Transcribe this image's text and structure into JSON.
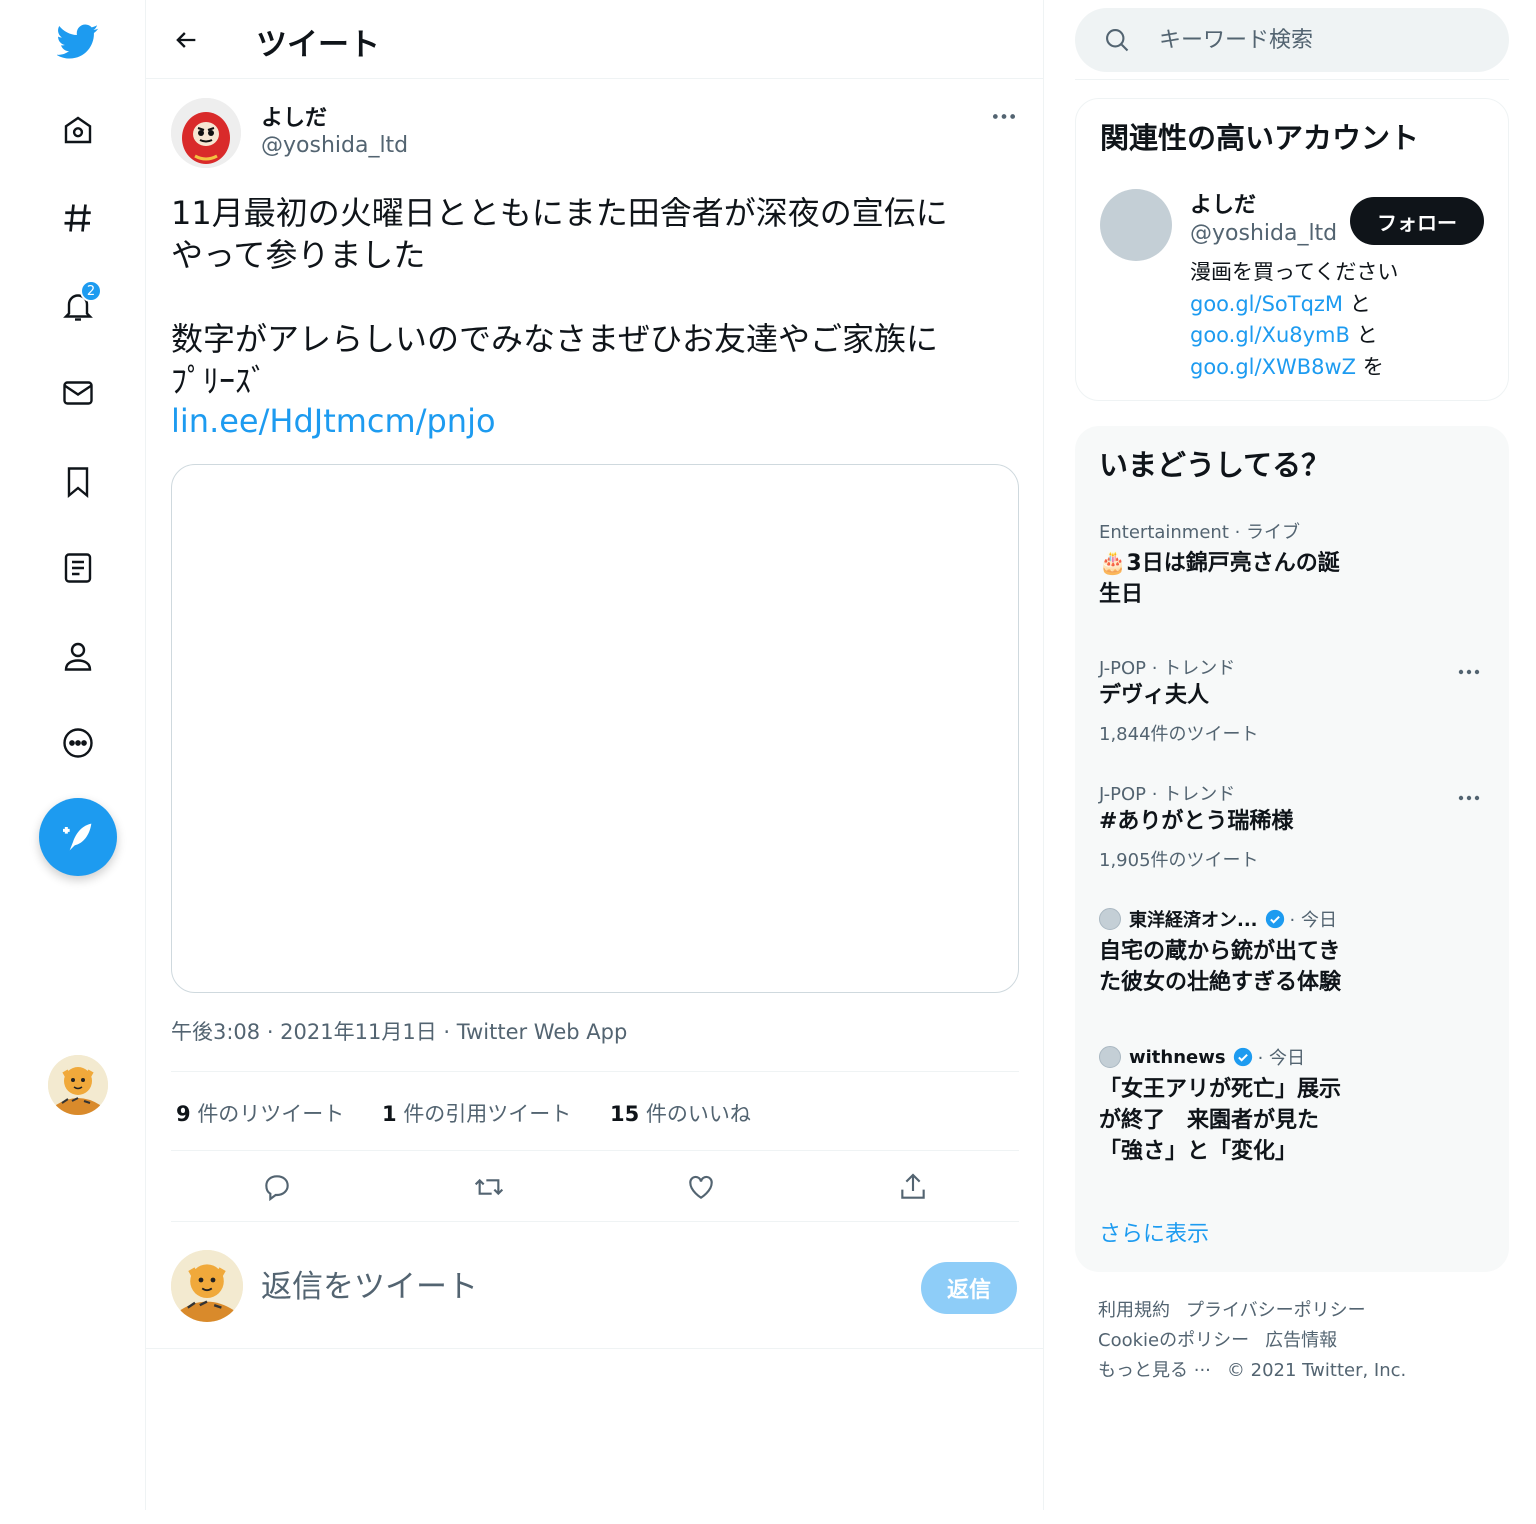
{
  "nav": {
    "notification_count": "2",
    "icons": [
      "twitter-logo-icon",
      "home-icon",
      "explore-hash-icon",
      "bell-icon",
      "mail-icon",
      "bookmark-icon",
      "lists-icon",
      "profile-icon",
      "more-icon",
      "compose-icon"
    ]
  },
  "header": {
    "title": "ツイート"
  },
  "tweet": {
    "author_name": "よしだ",
    "author_handle": "@yoshida_ltd",
    "text_line1": "11月最初の火曜日とともにまた田舎者が深夜の宣伝に",
    "text_line2": "やって参りました",
    "text_line3": "数字がアレらしいのでみなさまぜひお友達やご家族に",
    "text_line4": "ﾌﾟﾘｰｽﾞ",
    "link": "lin.ee/HdJtmcm/pnjo",
    "meta": "午後3:08 · 2021年11月1日 · Twitter Web App",
    "retweets": {
      "count": "9",
      "label": "件のリツイート"
    },
    "quotes": {
      "count": "1",
      "label": "件の引用ツイート"
    },
    "likes": {
      "count": "15",
      "label": "件のいいね"
    }
  },
  "reply": {
    "placeholder": "返信をツイート",
    "button": "返信"
  },
  "search": {
    "placeholder": "キーワード検索"
  },
  "accounts": {
    "title": "関連性の高いアカウント",
    "name": "よしだ",
    "handle": "@yoshida_ltd",
    "follow": "フォロー",
    "bio_line1": "漫画を買ってください",
    "link1": "goo.gl/SoTqzM",
    "link2": "goo.gl/Xu8ymB",
    "link3": "goo.gl/XWB8wZ",
    "conj_to": "と",
    "conj_wo": "を"
  },
  "trends": {
    "title": "いまどうしてる？",
    "items": [
      {
        "category": "Entertainment · ライブ",
        "title_line1": "🎂3日は錦戸亮さんの誕",
        "title_line2": "生日"
      },
      {
        "category": "J-POP · トレンド",
        "title": "デヴィ夫人",
        "count": "1,844件のツイート"
      },
      {
        "category": "J-POP · トレンド",
        "title": "#ありがとう瑞稀様",
        "count": "1,905件のツイート"
      }
    ],
    "news": [
      {
        "source": "東洋経済オン...",
        "time": "· 今日",
        "title_line1": "自宅の蔵から銃が出てき",
        "title_line2": "た彼女の壮絶すぎる体験"
      },
      {
        "source": "withnews",
        "time": "· 今日",
        "title_line1": "「女王アリが死亡」展示",
        "title_line2": "が終了　来園者が見た",
        "title_line3": "「強さ」と「変化」"
      }
    ],
    "show_more": "さらに表示"
  },
  "footer": {
    "terms": "利用規約",
    "privacy": "プライバシーポリシー",
    "cookie": "Cookieのポリシー",
    "ads": "広告情報",
    "more": "もっと見る ···",
    "copyright": "© 2021 Twitter, Inc."
  },
  "colors": {
    "accent": "#1d9bf0",
    "text": "#0f1419",
    "muted": "#536471",
    "border": "#eff3f4",
    "reply_button": "#8ecdf8"
  }
}
